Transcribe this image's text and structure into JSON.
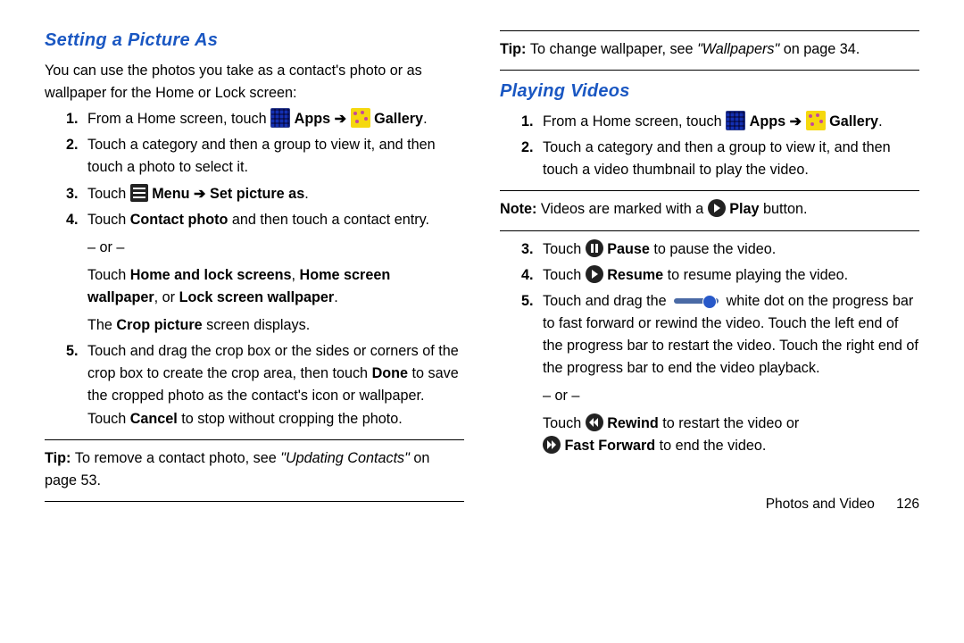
{
  "left": {
    "heading": "Setting a Picture As",
    "intro": "You can use the photos you take as a contact's photo or as wallpaper for the Home or Lock screen:",
    "step1_a": "From a Home screen, touch ",
    "step1_apps": "Apps",
    "step1_arrow": " ➔ ",
    "step1_gallery": "Gallery",
    "step1_end": ".",
    "step2": "Touch a category and then a group to view it, and then touch a photo to select it.",
    "step3_a": "Touch ",
    "step3_menu": "Menu",
    "step3_arrow": " ➔ ",
    "step3_set": "Set picture as",
    "step3_end": ".",
    "step4_a": "Touch ",
    "step4_contact": "Contact photo",
    "step4_b": " and then touch a contact entry.",
    "or": "– or –",
    "step4_c": "Touch ",
    "step4_home": "Home and lock screens",
    "step4_comma1": ", ",
    "step4_hsw": "Home screen wallpaper",
    "step4_comma2": ", or ",
    "step4_lsw": "Lock screen wallpaper",
    "step4_end": ".",
    "crop_a": "The ",
    "crop_b": "Crop picture",
    "crop_c": " screen displays.",
    "step5_a": "Touch and drag the crop box or the sides or corners of the crop box to create the crop area, then touch ",
    "step5_done": "Done",
    "step5_b": " to save the cropped photo as the contact's icon or wallpaper. Touch ",
    "step5_cancel": "Cancel",
    "step5_c": " to stop without cropping the photo.",
    "tip_a": "Tip: ",
    "tip_b": "To remove a contact photo, see ",
    "tip_link": "\"Updating Contacts\"",
    "tip_c": " on page 53."
  },
  "right": {
    "tip_a": "Tip: ",
    "tip_b": "To change wallpaper, see ",
    "tip_link": "\"Wallpapers\"",
    "tip_c": " on page 34.",
    "heading": "Playing Videos",
    "step1_a": "From a Home screen, touch ",
    "step1_apps": "Apps",
    "step1_arrow": " ➔ ",
    "step1_gallery": "Gallery",
    "step1_end": ".",
    "step2": "Touch a category and then a group to view it, and then touch a video thumbnail to play the video.",
    "note_a": "Note: ",
    "note_b": "Videos are marked with a ",
    "note_play": "Play",
    "note_c": " button.",
    "step3_a": "Touch ",
    "step3_pause": "Pause",
    "step3_b": " to pause the video.",
    "step4_a": "Touch ",
    "step4_resume": "Resume",
    "step4_b": " to resume playing the video.",
    "step5_a": "Touch and drag the ",
    "step5_b": " white dot on the progress bar to fast forward or rewind the video. Touch the left end of the progress bar to restart the video. Touch the right end of the progress bar to end the video playback.",
    "or": "– or –",
    "step5_c": "Touch ",
    "step5_rewind": "Rewind",
    "step5_d": " to restart the video or ",
    "step5_ff": "Fast Forward",
    "step5_e": " to end the video.",
    "footer_section": "Photos and Video",
    "footer_page": "126"
  }
}
